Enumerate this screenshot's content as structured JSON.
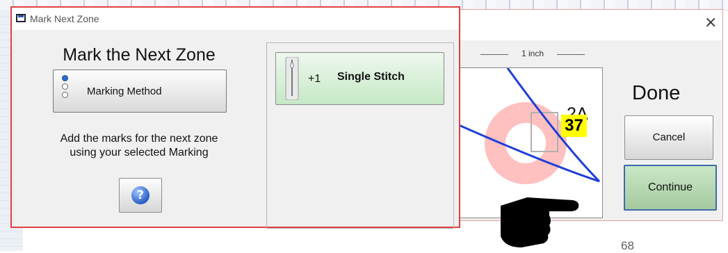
{
  "page": {
    "number": "68"
  },
  "front_dialog": {
    "title": "Mark Next Zone",
    "heading": "Mark the Next Zone",
    "marking_method_label": "Marking Method",
    "description_line1": "Add the marks for the next zone",
    "description_line2": "using your selected Marking",
    "help_label": "?",
    "stitch_prefix": "+1",
    "stitch_label": "Single Stitch"
  },
  "back_dialog": {
    "close_label": "×",
    "ruler_label": "1 inch",
    "zone_label": "2A",
    "zone_number": "37",
    "done_label": "Done",
    "cancel_label": "Cancel",
    "continue_label": "Continue"
  },
  "colors": {
    "dialog_border": "#e04040",
    "zone_highlight": "#ffff00",
    "continue_button": "#a6c9a0",
    "marking_line": "#1f3fd6",
    "preview_ring": "#ffc0c0"
  },
  "icons": {
    "title": "window-icon",
    "help": "help-icon",
    "stitch": "needle-icon",
    "pointer": "pointing-hand-icon"
  }
}
